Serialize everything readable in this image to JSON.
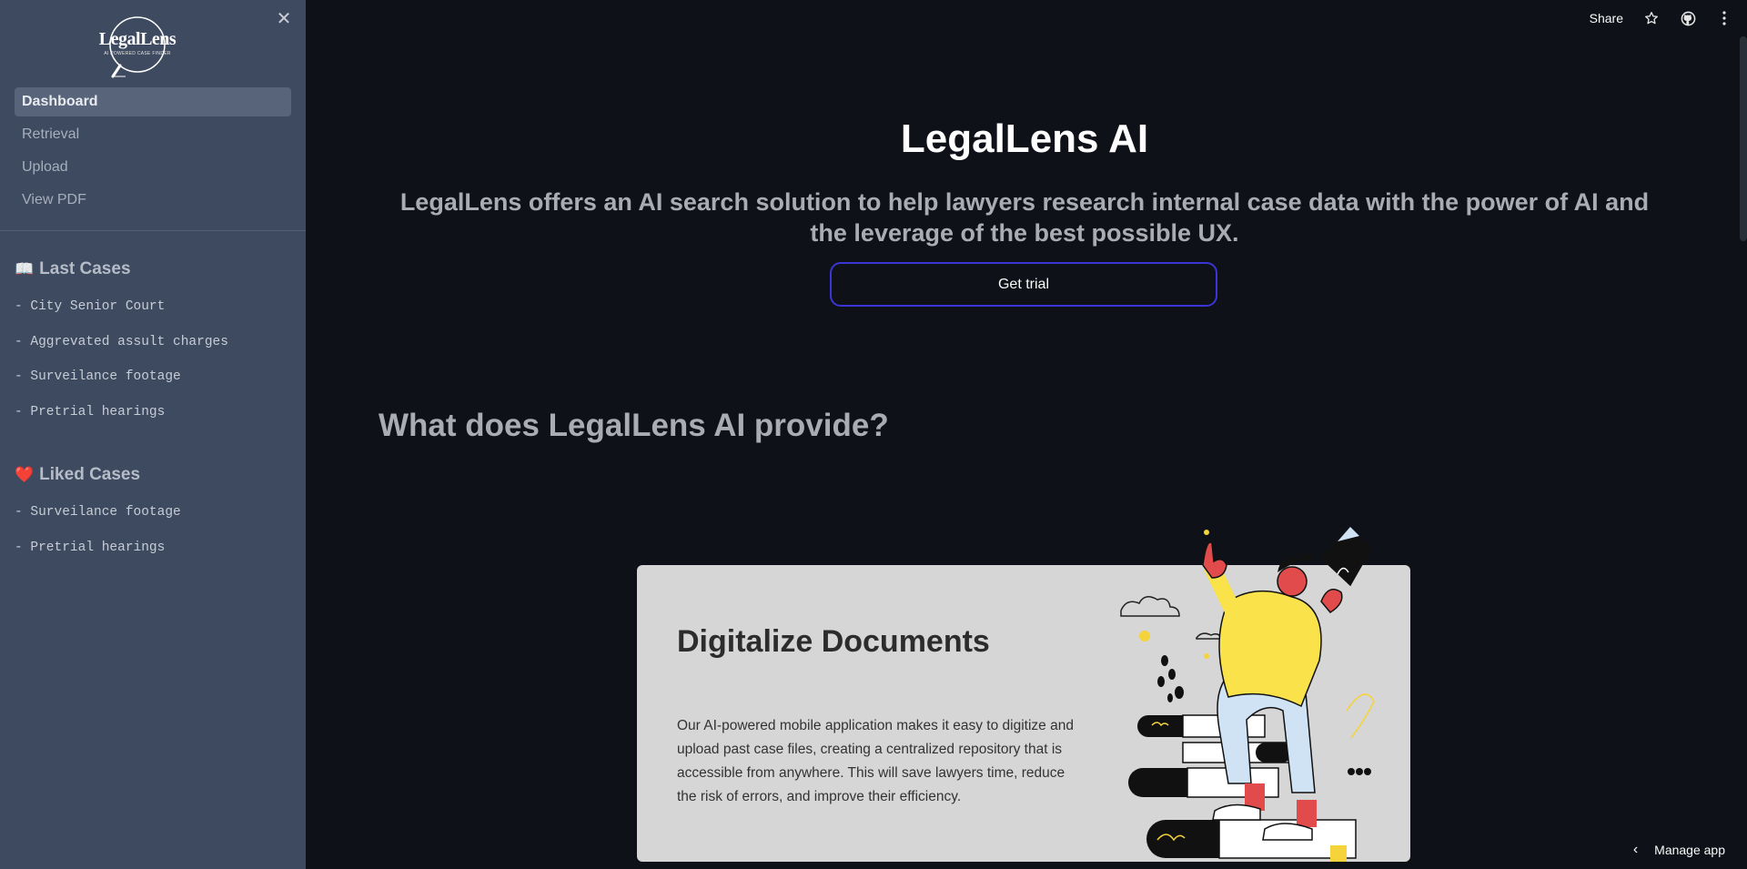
{
  "sidebar": {
    "logo": {
      "name": "LegalLens",
      "tagline": "AI POWERED CASE FINDER"
    },
    "nav": [
      {
        "label": "Dashboard",
        "active": true
      },
      {
        "label": "Retrieval",
        "active": false
      },
      {
        "label": "Upload",
        "active": false
      },
      {
        "label": "View PDF",
        "active": false
      }
    ],
    "last_cases": {
      "icon": "📖",
      "title": "Last Cases",
      "items": [
        "- City Senior Court",
        "- Aggrevated assult charges",
        "- Surveilance footage",
        "- Pretrial hearings"
      ]
    },
    "liked_cases": {
      "icon": "❤️",
      "title": "Liked Cases",
      "items": [
        "- Surveilance footage",
        "- Pretrial hearings"
      ]
    }
  },
  "toolbar": {
    "share_label": "Share",
    "icons": [
      "star-icon",
      "github-icon",
      "more-icon"
    ]
  },
  "main": {
    "title": "LegalLens AI",
    "subtitle": "LegalLens offers an AI search solution to help lawyers research internal case data with the power of AI and the leverage of the best possible UX.",
    "cta_label": "Get trial",
    "section_heading": "What does LegalLens AI provide?",
    "card": {
      "title": "Digitalize Documents",
      "body": "Our AI-powered mobile application makes it easy to digitize and upload past case files, creating a centralized repository that is accessible from anywhere. This will save lawyers time, reduce the risk of errors, and improve their efficiency."
    }
  },
  "footer": {
    "manage_label": "Manage app"
  },
  "colors": {
    "sidebar_bg": "#3d4a5f",
    "main_bg": "#0e1117",
    "accent_border": "#3b35d6",
    "card_bg": "#d6d6d6"
  }
}
